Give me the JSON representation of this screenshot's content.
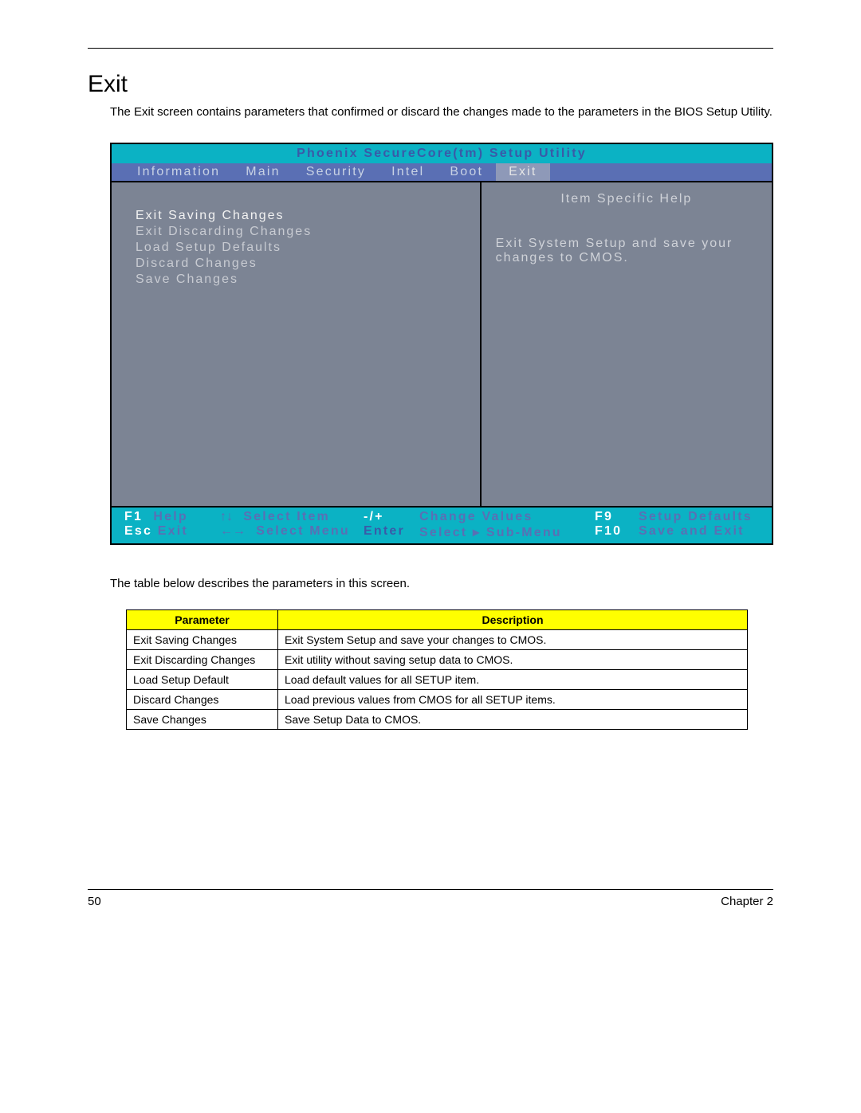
{
  "section": {
    "title": "Exit",
    "intro": "The Exit screen contains parameters that confirmed or discard the changes made to the parameters in the BIOS Setup Utility."
  },
  "bios": {
    "title": "Phoenix SecureCore(tm) Setup Utility",
    "tabs": [
      "Information",
      "Main",
      "Security",
      "Intel",
      "Boot",
      "Exit"
    ],
    "active_tab_index": 5,
    "menu": [
      "Exit Saving Changes",
      "Exit Discarding Changes",
      "Load Setup Defaults",
      "Discard Changes",
      "Save Changes"
    ],
    "selected_index": 0,
    "help": {
      "title": "Item Specific Help",
      "body": "Exit System Setup and save your changes to CMOS."
    },
    "footer": {
      "r1": {
        "k1": "F1",
        "l1": "Help",
        "sym1": "↑↓",
        "l2": "Select Item",
        "k2": "-/+",
        "l3": "Change Values",
        "k3": "F9",
        "l4": "Setup Defaults"
      },
      "r2": {
        "k1": "Esc",
        "l1": "Exit",
        "sym1": "←→",
        "l2": "Select Menu",
        "k2": "Enter",
        "l3": "Select  ▸ Sub-Menu",
        "k3": "F10",
        "l4": "Save and Exit"
      }
    }
  },
  "table_note": "The table below describes the parameters in this screen.",
  "param_table": {
    "headers": {
      "param": "Parameter",
      "desc": "Description"
    },
    "rows": [
      {
        "param": "Exit Saving Changes",
        "desc": "Exit System Setup and save your changes to CMOS."
      },
      {
        "param": "Exit Discarding Changes",
        "desc": "Exit utility without saving setup data to CMOS."
      },
      {
        "param": "Load Setup Default",
        "desc": "Load default values for all SETUP item."
      },
      {
        "param": "Discard Changes",
        "desc": "Load previous values from CMOS for all SETUP items."
      },
      {
        "param": "Save Changes",
        "desc": "Save Setup Data to CMOS."
      }
    ]
  },
  "footer": {
    "page": "50",
    "chapter": "Chapter 2"
  }
}
